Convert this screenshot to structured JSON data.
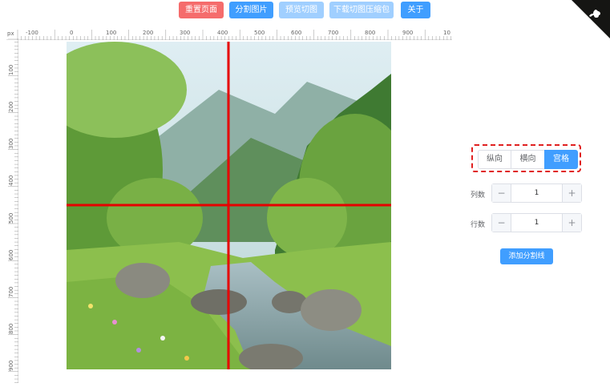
{
  "toolbar": {
    "reset_label": "重置页面",
    "split_label": "分割图片",
    "preview_label": "预览切图",
    "download_label": "下载切图压缩包",
    "about_label": "关于"
  },
  "ruler": {
    "unit": "px",
    "top_labels": [
      "-100",
      "0",
      "100",
      "200",
      "300",
      "400",
      "500",
      "600",
      "700",
      "800",
      "900",
      "10"
    ],
    "left_labels": [
      "100",
      "200",
      "300",
      "400",
      "500",
      "600",
      "700",
      "800",
      "900"
    ]
  },
  "split_mode": {
    "options": [
      "纵向",
      "横向",
      "宫格"
    ],
    "selected": "宫格"
  },
  "columns": {
    "label": "列数",
    "value": "1",
    "minus": "−",
    "plus": "+"
  },
  "rows": {
    "label": "行数",
    "value": "1",
    "minus": "−",
    "plus": "+"
  },
  "add_line_label": "添加分割线",
  "colors": {
    "primary": "#409eff",
    "danger": "#f56c6c",
    "disabled": "#a0cfff",
    "split_line": "#e60000"
  },
  "icons": {
    "corner": "github-corner-icon"
  }
}
